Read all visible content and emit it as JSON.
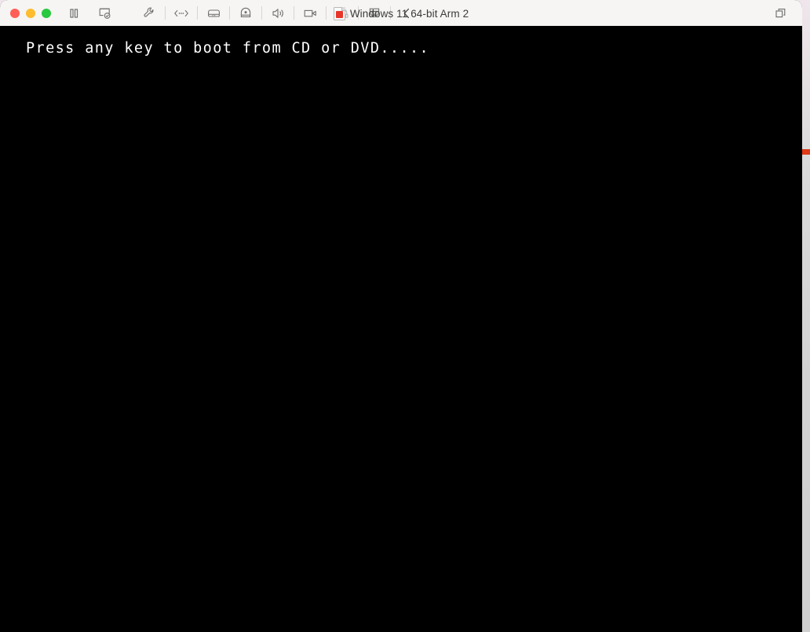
{
  "window": {
    "title": "Windows 11 64-bit Arm 2",
    "doc_icon_glyph": "⌘",
    "traffic_lights": [
      {
        "name": "close",
        "label": "Close",
        "color": "#ff5f57"
      },
      {
        "name": "minimize",
        "label": "Minimize",
        "color": "#febc2e"
      },
      {
        "name": "maximize",
        "label": "Maximize",
        "color": "#28c840"
      }
    ]
  },
  "toolbar": {
    "items": [
      {
        "name": "pause-button",
        "icon": "pause-icon",
        "label": "Pause",
        "enabled": true
      },
      {
        "name": "snapshot-button",
        "icon": "snapshot-icon",
        "label": "Snapshot",
        "enabled": true
      },
      {
        "name": "settings-button",
        "icon": "wrench-icon",
        "label": "Settings",
        "enabled": true
      },
      {
        "name": "network-button",
        "icon": "network-icon",
        "label": "Network Adapter",
        "enabled": true
      },
      {
        "name": "hard-disk-button",
        "icon": "hard-disk-icon",
        "label": "Hard Disk",
        "enabled": true
      },
      {
        "name": "camera-button",
        "icon": "camera-icon",
        "label": "Camera",
        "enabled": true
      },
      {
        "name": "sound-button",
        "icon": "speaker-icon",
        "label": "Sound",
        "enabled": true
      },
      {
        "name": "video-button",
        "icon": "video-camera-icon",
        "label": "Video",
        "enabled": true
      },
      {
        "name": "headphones-button",
        "icon": "headphones-icon",
        "label": "Headphones",
        "enabled": false
      },
      {
        "name": "shared-folders-button",
        "icon": "stack-icon",
        "label": "Shared Folders",
        "enabled": true
      },
      {
        "name": "collapse-button",
        "icon": "chevron-left-icon",
        "label": "Collapse Toolbar",
        "enabled": true
      }
    ],
    "right_control": {
      "name": "view-mode-button",
      "icon": "windows-overlap-icon",
      "label": "View Mode"
    }
  },
  "vm_screen": {
    "boot_message": "Press any key to boot from CD or DVD.....",
    "background_color": "#000000",
    "text_color": "#ffffff",
    "bottom_partial_text": "_____ ___ __ _ __ _ ___ __ _ ___ __ _ _ __"
  }
}
